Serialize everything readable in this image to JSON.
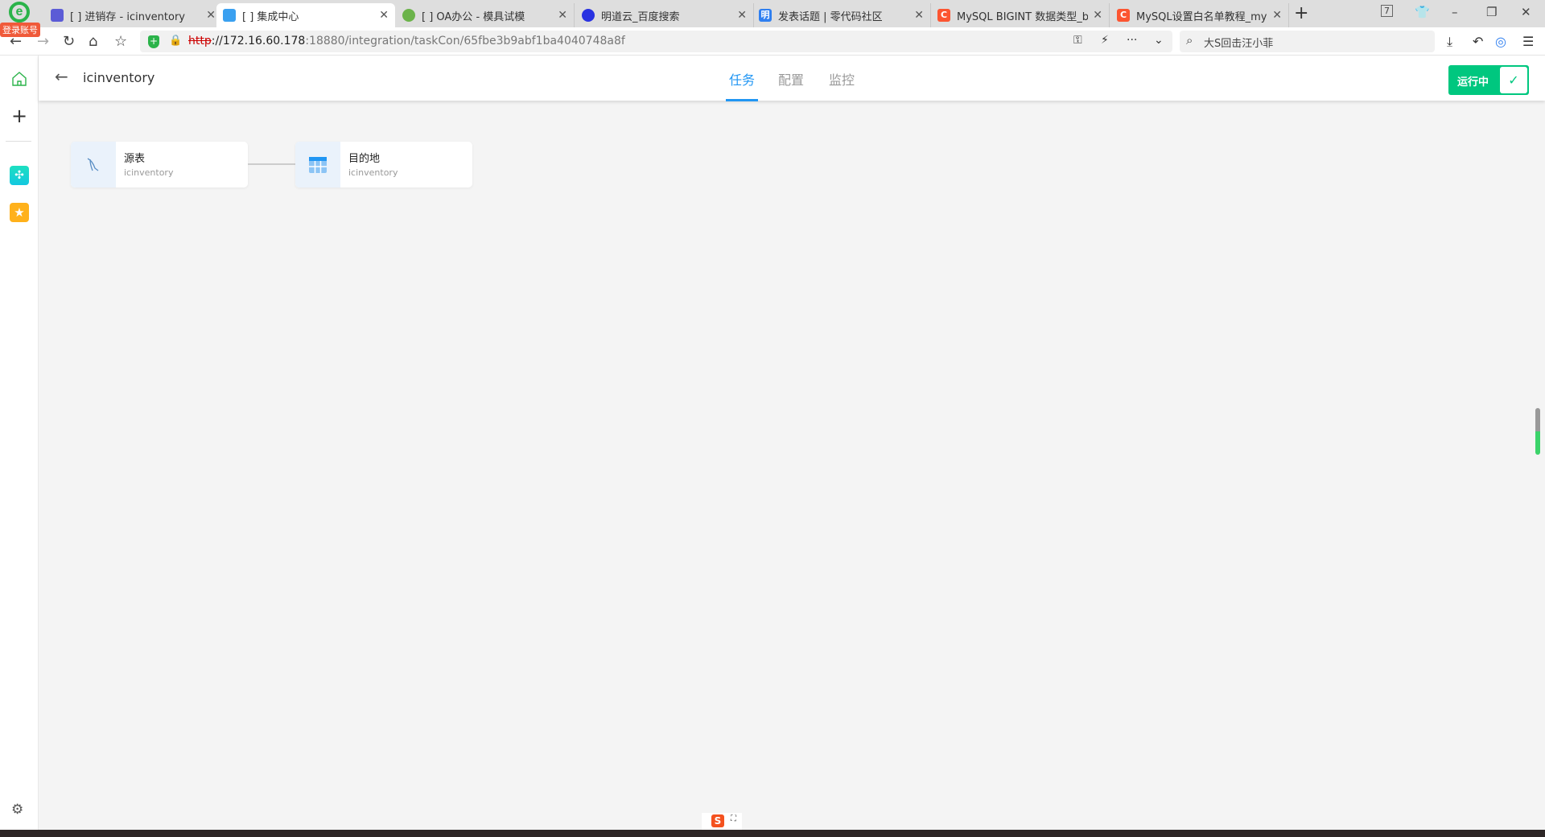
{
  "browser": {
    "account_badge": "登录账号",
    "tabs": [
      {
        "title": "[        ] 进销存 - icinventory",
        "icon": "app-icon",
        "color": "#5b5bd6",
        "active": false
      },
      {
        "title": "[        ] 集成中心",
        "icon": "cube-icon",
        "color": "#3aa0f0",
        "active": true
      },
      {
        "title": "[        ] OA办公 - 模具试模",
        "icon": "app-icon",
        "color": "#6bb34a",
        "active": false
      },
      {
        "title": "明道云_百度搜索",
        "icon": "baidu-icon",
        "color": "#2932e1",
        "active": false
      },
      {
        "title": "发表话题 | 零代码社区",
        "icon": "mingdao-icon",
        "color": "#2f7ff0",
        "active": false
      },
      {
        "title": "MySQL BIGINT 数据类型_bigint",
        "icon": "csdn-icon",
        "color": "#fc5531",
        "active": false
      },
      {
        "title": "MySQL设置白名单教程_mysql",
        "icon": "csdn-icon",
        "color": "#fc5531",
        "active": false
      }
    ],
    "new_tab": "+",
    "tab_count": "7",
    "url_protocol": "http",
    "url_host": "://172.16.60.178",
    "url_rest": ":18880/integration/taskCon/65fbe3b9abf1ba4040748a8f",
    "search_text": "大S回击汪小菲"
  },
  "header": {
    "title": "icinventory",
    "tabs": [
      {
        "label": "任务",
        "active": true
      },
      {
        "label": "配置",
        "active": false
      },
      {
        "label": "监控",
        "active": false
      }
    ],
    "status_label": "运行中",
    "status_color": "#00c77f"
  },
  "flow": {
    "source": {
      "label": "源表",
      "sub": "icinventory"
    },
    "destination": {
      "label": "目的地",
      "sub": "icinventory"
    }
  },
  "accent": "#2196f3"
}
